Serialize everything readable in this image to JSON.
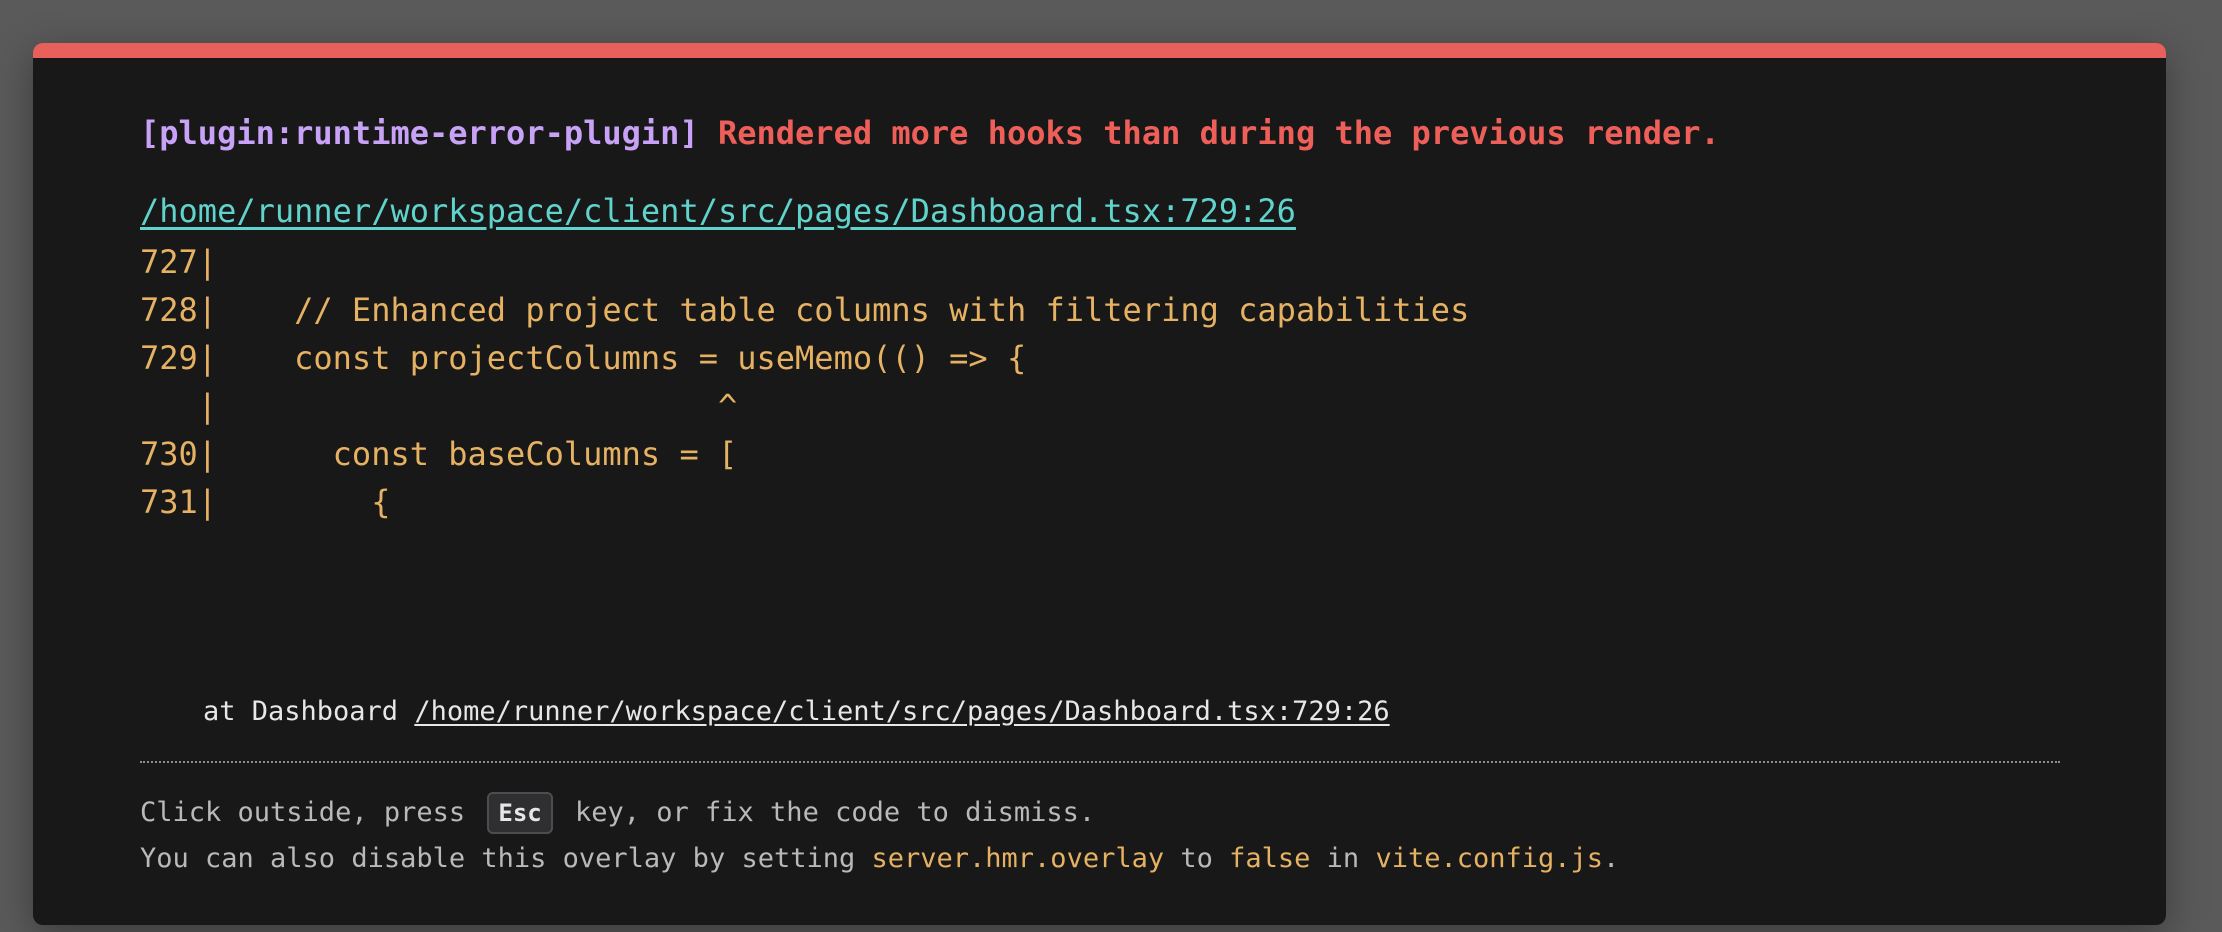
{
  "error": {
    "plugin": "[plugin:runtime-error-plugin]",
    "message": "Rendered more hooks than during the previous render."
  },
  "file": {
    "path": "/home/runner/workspace/client/src/pages/Dashboard.tsx:729:26"
  },
  "frame": {
    "lines": [
      "727|",
      "728|    // Enhanced project table columns with filtering capabilities",
      "729|    const projectColumns = useMemo(() => {",
      "   |                          ^",
      "730|      const baseColumns = [",
      "731|        {"
    ]
  },
  "stack": {
    "prefix": "at Dashboard ",
    "location": "/home/runner/workspace/client/src/pages/Dashboard.tsx:729:26"
  },
  "tip": {
    "line1_before": "Click outside, press ",
    "key": "Esc",
    "line1_after": " key, or fix the code to dismiss.",
    "line2_before": "You can also disable this overlay by setting ",
    "config_key": "server.hmr.overlay",
    "line2_mid": " to ",
    "false_value": "false",
    "line2_mid2": " in ",
    "config_file": "vite.config.js",
    "line2_end": "."
  },
  "colors": {
    "accent_bar": "#e8605c",
    "plugin": "#c8a2f7",
    "error": "#ef5f5a",
    "link": "#5fd3cc",
    "code": "#e5b163"
  }
}
